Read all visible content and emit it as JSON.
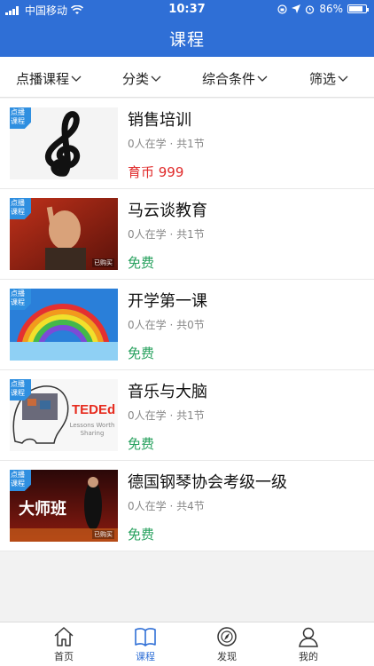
{
  "status_bar": {
    "carrier": "中国移动",
    "time": "10:37",
    "battery": "86%",
    "battery_level": 0.86
  },
  "header": {
    "title": "课程"
  },
  "filters": [
    {
      "label": "点播课程"
    },
    {
      "label": "分类"
    },
    {
      "label": "综合条件"
    },
    {
      "label": "筛选"
    }
  ],
  "courses": [
    {
      "title": "销售培训",
      "meta": "0人在学 · 共1节",
      "price": "育币 999",
      "tag": "点播课程",
      "price_type": "paid"
    },
    {
      "title": "马云谈教育",
      "meta": "0人在学 · 共1节",
      "price": "免费",
      "tag": "点播课程",
      "price_type": "free",
      "thumb_caption": "已购买"
    },
    {
      "title": "开学第一课",
      "meta": "0人在学 · 共0节",
      "price": "免费",
      "tag": "点播课程",
      "price_type": "free"
    },
    {
      "title": "音乐与大脑",
      "meta": "0人在学 · 共1节",
      "price": "免费",
      "tag": "点播课程",
      "price_type": "free"
    },
    {
      "title": "德国钢琴协会考级一级",
      "meta": "0人在学 · 共4节",
      "price": "免费",
      "tag": "点播课程",
      "price_type": "free",
      "thumb_caption": "已购买"
    }
  ],
  "thumb_texts": {
    "ted_brand": "TEDEd",
    "ted_tagline": "Lessons Worth Sharing",
    "master_class": "大师班"
  },
  "tabbar": [
    {
      "label": "首页",
      "icon": "home-icon"
    },
    {
      "label": "课程",
      "icon": "book-icon"
    },
    {
      "label": "发现",
      "icon": "compass-icon"
    },
    {
      "label": "我的",
      "icon": "user-icon"
    }
  ],
  "colors": {
    "header_blue": "#2f6fd6",
    "paid_red": "#e02a2a",
    "free_green": "#27a15e",
    "tag_blue": "#2f8fe0"
  }
}
